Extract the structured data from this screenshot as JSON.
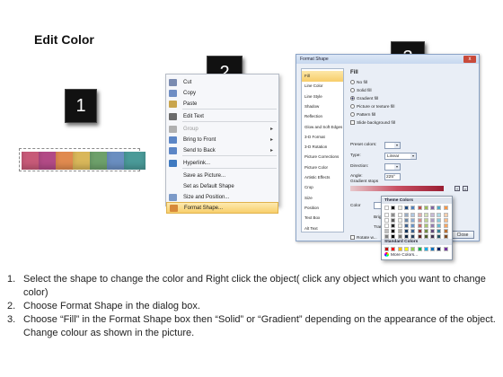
{
  "title": "Edit Color",
  "badges": [
    "1",
    "2",
    "3"
  ],
  "strip": {
    "colors": [
      "#c75a78",
      "#b24a86",
      "#e08a4f",
      "#d9b75a",
      "#6da06a",
      "#6a8ec0",
      "#4a9a98"
    ]
  },
  "context_menu": {
    "items": [
      {
        "label": "Cut",
        "icon": "scissors-icon",
        "enabled": true,
        "submenu": false
      },
      {
        "label": "Copy",
        "icon": "copy-icon",
        "enabled": true,
        "submenu": false
      },
      {
        "label": "Paste",
        "icon": "paste-icon",
        "enabled": true,
        "submenu": false
      },
      {
        "label": "Edit Text",
        "icon": "edit-text-icon",
        "enabled": true,
        "submenu": false
      },
      {
        "label": "Group",
        "icon": "group-icon",
        "enabled": false,
        "submenu": true
      },
      {
        "label": "Bring to Front",
        "icon": "bring-front-icon",
        "enabled": true,
        "submenu": true
      },
      {
        "label": "Send to Back",
        "icon": "send-back-icon",
        "enabled": true,
        "submenu": true
      },
      {
        "label": "Hyperlink...",
        "icon": "hyperlink-icon",
        "enabled": true,
        "submenu": false
      },
      {
        "label": "Save as Picture...",
        "icon": "",
        "enabled": true,
        "submenu": false
      },
      {
        "label": "Set as Default Shape",
        "icon": "",
        "enabled": true,
        "submenu": false
      },
      {
        "label": "Size and Position...",
        "icon": "size-icon",
        "enabled": true,
        "submenu": false
      },
      {
        "label": "Format Shape...",
        "icon": "format-shape-icon",
        "enabled": true,
        "submenu": false,
        "highlighted": true
      }
    ]
  },
  "dialog": {
    "title": "Format Shape",
    "close_glyph": "x",
    "nav": [
      "Fill",
      "Line Color",
      "Line Style",
      "Shadow",
      "Reflection",
      "Glow and Soft Edges",
      "3-D Format",
      "3-D Rotation",
      "Picture Corrections",
      "Picture Color",
      "Artistic Effects",
      "Crop",
      "Size",
      "Position",
      "Text Box",
      "Alt Text"
    ],
    "selected_nav": "Fill",
    "fill": {
      "heading": "Fill",
      "options": [
        "No fill",
        "Solid fill",
        "Gradient fill",
        "Picture or texture fill",
        "Pattern fill",
        "Slide background fill"
      ],
      "selected_option": "Gradient fill",
      "preset_colors_label": "Preset colors:",
      "type_label": "Type:",
      "type_value": "Linear",
      "direction_label": "Direction:",
      "angle_label": "Angle:",
      "angle_value": "225°",
      "gradient_stops_label": "Gradient stops",
      "color_label": "Color",
      "position_label": "Position:",
      "position_value": "100%",
      "brightness_label": "Brightness",
      "transparency_label": "Transparency",
      "rotate_label": "Rotate w..."
    },
    "close_button": "Close"
  },
  "color_popup": {
    "theme_heading": "Theme Colors",
    "standard_heading": "Standard Colors",
    "more_colors": "More Colors...",
    "theme_top": [
      "#ffffff",
      "#000000",
      "#eeece1",
      "#1f497d",
      "#4f81bd",
      "#c0504d",
      "#9bbb59",
      "#8064a2",
      "#4bacc6",
      "#f79646"
    ],
    "standard": [
      "#c00000",
      "#ff0000",
      "#ffc000",
      "#ffff00",
      "#92d050",
      "#00b050",
      "#00b0f0",
      "#0070c0",
      "#002060",
      "#7030a0"
    ]
  },
  "instructions": [
    {
      "num": "1.",
      "text": "Select the shape to change the color and Right click the object( click any object which you want to change color)"
    },
    {
      "num": "2.",
      "text": "Choose Format Shape in the dialog box."
    },
    {
      "num": "3.",
      "text": "Choose “Fill” in the Format Shape box then “Solid” or “Gradient” depending on the appearance of the object. Change colour as shown in the picture."
    }
  ]
}
